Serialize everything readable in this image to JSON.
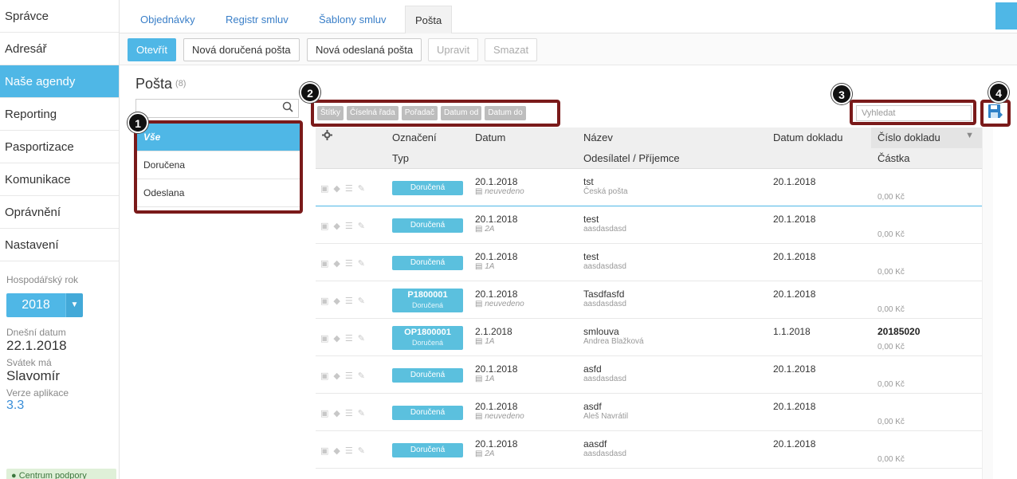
{
  "sidebar": {
    "items": [
      {
        "label": "Správce"
      },
      {
        "label": "Adresář"
      },
      {
        "label": "Naše agendy"
      },
      {
        "label": "Reporting"
      },
      {
        "label": "Pasportizace"
      },
      {
        "label": "Komunikace"
      },
      {
        "label": "Oprávnění"
      },
      {
        "label": "Nastavení"
      }
    ],
    "active_index": 2,
    "fiscal_year_label": "Hospodářský rok",
    "fiscal_year_value": "2018",
    "today_label": "Dnešní datum",
    "today_value": "22.1.2018",
    "nameday_label": "Svátek má",
    "nameday_value": "Slavomír",
    "version_label": "Verze aplikace",
    "version_value": "3.3",
    "support_label": "Centrum podpory"
  },
  "tabs": [
    "Objednávky",
    "Registr smluv",
    "Šablony smluv",
    "Pošta"
  ],
  "toolbar": {
    "open": "Otevřít",
    "new_incoming": "Nová doručená pošta",
    "new_outgoing": "Nová odeslaná pošta",
    "edit": "Upravit",
    "delete": "Smazat"
  },
  "section": {
    "title": "Pošta",
    "count": "(8)"
  },
  "filters": [
    "Vše",
    "Doručena",
    "Odeslana"
  ],
  "tag_chips": [
    "Štítky",
    "Číselná řada",
    "Pořadač",
    "Datum od",
    "Datum do"
  ],
  "search": {
    "placeholder": "Vyhledat"
  },
  "badges": [
    "1",
    "2",
    "3",
    "4"
  ],
  "table": {
    "header1": {
      "oznaceni": "Označení",
      "datum": "Datum",
      "nazev": "Název",
      "datum_dokladu": "Datum dokladu",
      "cislo_dokladu": "Číslo dokladu"
    },
    "header2": {
      "typ": "Typ",
      "odesilatel": "Odesílatel / Příjemce",
      "castka": "Částka"
    },
    "rows": [
      {
        "code": "",
        "type": "Doručená",
        "date": "20.1.2018",
        "folder": "neuvedeno",
        "name": "tst",
        "party": "Česká pošta",
        "doc_date": "20.1.2018",
        "doc_no": "",
        "amount": "0,00 Kč"
      },
      {
        "code": "",
        "type": "Doručená",
        "date": "20.1.2018",
        "folder": "2A",
        "name": "test",
        "party": "aasdasdasd",
        "doc_date": "20.1.2018",
        "doc_no": "",
        "amount": "0,00 Kč"
      },
      {
        "code": "",
        "type": "Doručená",
        "date": "20.1.2018",
        "folder": "1A",
        "name": "test",
        "party": "aasdasdasd",
        "doc_date": "20.1.2018",
        "doc_no": "",
        "amount": "0,00 Kč"
      },
      {
        "code": "P1800001",
        "type": "Doručená",
        "date": "20.1.2018",
        "folder": "neuvedeno",
        "name": "Tasdfasfd",
        "party": "aasdasdasd",
        "doc_date": "20.1.2018",
        "doc_no": "",
        "amount": "0,00 Kč"
      },
      {
        "code": "OP1800001",
        "type": "Doručená",
        "date": "2.1.2018",
        "folder": "1A",
        "name": "smlouva",
        "party": "Andrea Blažková",
        "doc_date": "1.1.2018",
        "doc_no": "20185020",
        "amount": "0,00 Kč"
      },
      {
        "code": "",
        "type": "Doručená",
        "date": "20.1.2018",
        "folder": "1A",
        "name": "asfd",
        "party": "aasdasdasd",
        "doc_date": "20.1.2018",
        "doc_no": "",
        "amount": "0,00 Kč"
      },
      {
        "code": "",
        "type": "Doručená",
        "date": "20.1.2018",
        "folder": "neuvedeno",
        "name": "asdf",
        "party": "Aleš Navrátil",
        "doc_date": "20.1.2018",
        "doc_no": "",
        "amount": "0,00 Kč"
      },
      {
        "code": "",
        "type": "Doručená",
        "date": "20.1.2018",
        "folder": "2A",
        "name": "aasdf",
        "party": "aasdasdasd",
        "doc_date": "20.1.2018",
        "doc_no": "",
        "amount": "0,00 Kč"
      }
    ]
  },
  "colors": {
    "accent": "#4fb7e6",
    "highlight_border": "#7a1a1a",
    "pill": "#5bc0de"
  }
}
